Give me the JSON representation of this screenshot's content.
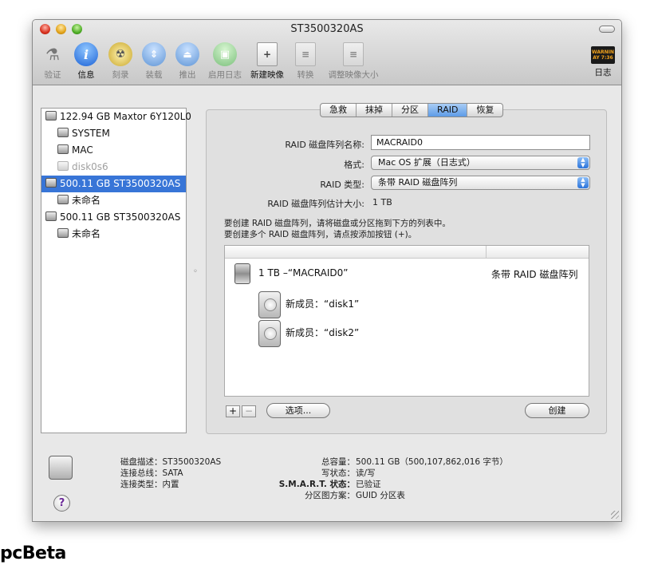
{
  "window": {
    "title": "ST3500320AS"
  },
  "toolbar": [
    {
      "label": "验证",
      "icon": "microscope-icon",
      "enabled": false
    },
    {
      "label": "信息",
      "icon": "info-icon",
      "enabled": true
    },
    {
      "label": "刻录",
      "icon": "burn-icon",
      "enabled": false
    },
    {
      "label": "装载",
      "icon": "mount-icon",
      "enabled": false
    },
    {
      "label": "推出",
      "icon": "eject-icon",
      "enabled": false
    },
    {
      "label": "启用日志",
      "icon": "journal-icon",
      "enabled": false
    },
    {
      "label": "新建映像",
      "icon": "new-image-icon",
      "enabled": true
    },
    {
      "label": "转换",
      "icon": "convert-icon",
      "enabled": false
    },
    {
      "label": "调整映像大小",
      "icon": "resize-image-icon",
      "enabled": false
    },
    {
      "label": "日志",
      "icon": "log-icon",
      "enabled": true
    }
  ],
  "log_icon_text": "WARNIN\nAY 7:36",
  "sidebar": {
    "items": [
      {
        "label": "122.94 GB Maxtor 6Y120L0",
        "level": 0,
        "selected": false,
        "dim": false
      },
      {
        "label": "SYSTEM",
        "level": 1,
        "selected": false,
        "dim": false
      },
      {
        "label": "MAC",
        "level": 1,
        "selected": false,
        "dim": false
      },
      {
        "label": "disk0s6",
        "level": 1,
        "selected": false,
        "dim": true
      },
      {
        "label": "500.11 GB ST3500320AS",
        "level": 0,
        "selected": true,
        "dim": false
      },
      {
        "label": "未命名",
        "level": 1,
        "selected": false,
        "dim": false
      },
      {
        "label": "500.11 GB ST3500320AS",
        "level": 0,
        "selected": false,
        "dim": false
      },
      {
        "label": "未命名",
        "level": 1,
        "selected": false,
        "dim": false
      }
    ]
  },
  "tabs": [
    {
      "label": "急救",
      "active": false
    },
    {
      "label": "抹掉",
      "active": false
    },
    {
      "label": "分区",
      "active": false
    },
    {
      "label": "RAID",
      "active": true
    },
    {
      "label": "恢复",
      "active": false
    }
  ],
  "raid": {
    "name_label": "RAID 磁盘阵列名称:",
    "name_value": "MACRAID0",
    "format_label": "格式:",
    "format_value": "Mac OS 扩展（日志式）",
    "type_label": "RAID 类型:",
    "type_value": "条带 RAID 磁盘阵列",
    "size_label": "RAID 磁盘阵列估计大小:",
    "size_value": "1 TB",
    "help_line1": "要创建 RAID 磁盘阵列，请将磁盘或分区拖到下方的列表中。",
    "help_line2": "要创建多个 RAID 磁盘阵列，请点按添加按钮 (+)。"
  },
  "raid_list": {
    "set_name": "1 TB –“MACRAID0”",
    "set_type": "条带 RAID 磁盘阵列",
    "members": [
      "新成员：“disk1”",
      "新成员：“disk2”"
    ]
  },
  "buttons": {
    "add": "+",
    "remove": "−",
    "options": "选项...",
    "create": "创建"
  },
  "info": {
    "left": [
      {
        "label": "磁盘描述：",
        "value": "ST3500320AS"
      },
      {
        "label": "连接总线：",
        "value": "SATA"
      },
      {
        "label": "连接类型：",
        "value": "内置"
      }
    ],
    "right": [
      {
        "label": "总容量：",
        "value": "500.11 GB（500,107,862,016 字节）"
      },
      {
        "label": "写状态：",
        "value": "读/写"
      },
      {
        "label": "S.M.A.R.T. 状态：",
        "value": "已验证"
      },
      {
        "label": "分区图方案：",
        "value": "GUID 分区表"
      }
    ]
  },
  "help_button": "?",
  "watermark": "pcBeta"
}
